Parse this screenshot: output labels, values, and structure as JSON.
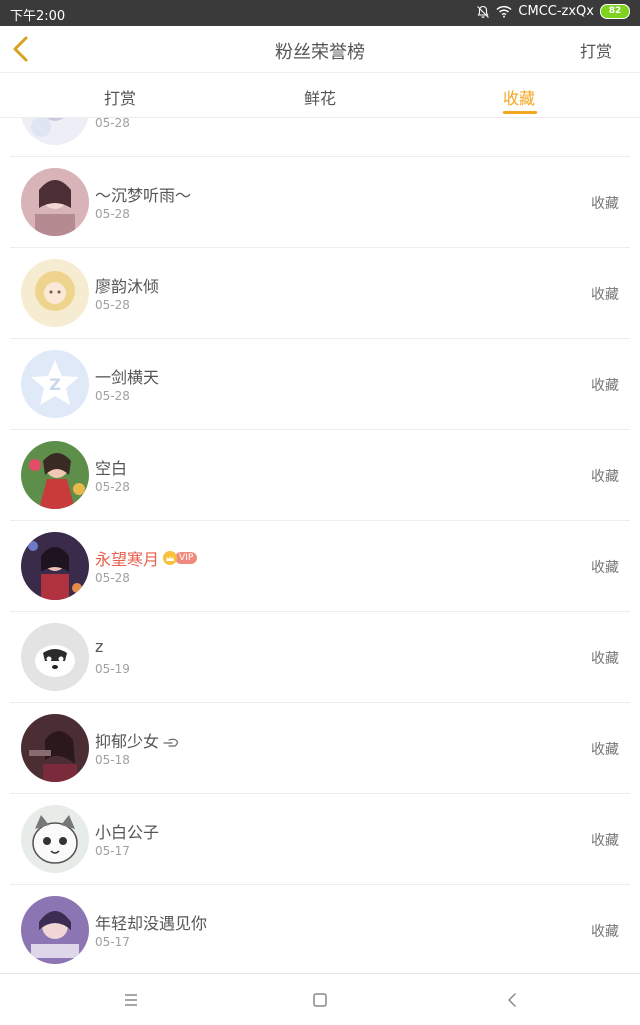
{
  "status_bar": {
    "time": "下午2:00",
    "carrier": "CMCC-zxQx",
    "battery": "82",
    "bell_icon": "bell-muted-icon",
    "wifi_icon": "wifi-icon"
  },
  "header": {
    "title": "粉丝荣誉榜",
    "right_label": "打赏",
    "back_icon": "chevron-left-icon"
  },
  "tabs": [
    {
      "label": "打赏",
      "active": false
    },
    {
      "label": "鲜花",
      "active": false
    },
    {
      "label": "收藏",
      "active": true
    }
  ],
  "list": {
    "rows": [
      {
        "name": "",
        "date": "05-28",
        "action": ""
      },
      {
        "name": "～沉梦听雨～",
        "date": "05-28",
        "action": "收藏"
      },
      {
        "name": "廖韵沐倾",
        "date": "05-28",
        "action": "收藏"
      },
      {
        "name": "一剑横天",
        "date": "05-28",
        "action": "收藏"
      },
      {
        "name": "空白",
        "date": "05-28",
        "action": "收藏"
      },
      {
        "name": "永望寒月",
        "date": "05-28",
        "action": "收藏",
        "vip": "VIP"
      },
      {
        "name": "z",
        "date": "05-19",
        "action": "收藏"
      },
      {
        "name": "抑郁少女",
        "date": "05-18",
        "action": "收藏"
      },
      {
        "name": "小白公子",
        "date": "05-17",
        "action": "收藏"
      },
      {
        "name": "年轻却没遇见你",
        "date": "05-17",
        "action": "收藏"
      }
    ]
  },
  "colors": {
    "accent": "#f5a623",
    "vip_name": "#e8604c",
    "text": "#555555",
    "subtext": "#a0a0a0",
    "divider": "#ececec"
  },
  "nav": {
    "menu_icon": "menu-icon",
    "home_icon": "square-home-icon",
    "back_icon": "back-triangle-icon"
  }
}
